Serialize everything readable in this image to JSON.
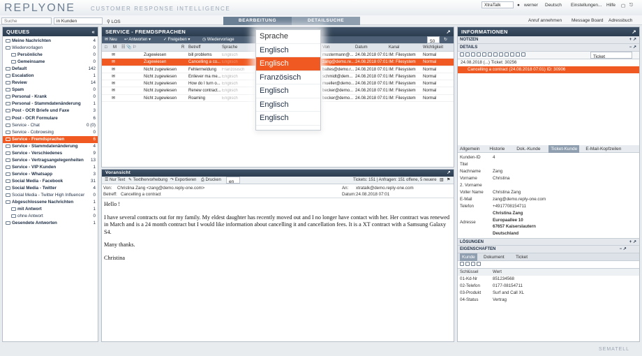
{
  "header": {
    "logo": "REPLYONE",
    "tagline": "CUSTOMER RESPONSE INTELLIGENCE",
    "app_select": "XtraTalk",
    "user": "werner",
    "language": "Deutsch",
    "settings": "Einstellungen...",
    "help": "Hilfe"
  },
  "search": {
    "placeholder": "Suche",
    "scope": "in Kunden",
    "go": "LOS"
  },
  "tabs": {
    "edit": "BEARBEITUNG",
    "search": "DETAILSUCHE"
  },
  "toplinks": {
    "call": "Anruf annehmen",
    "board": "Message Board",
    "book": "Adressbuch"
  },
  "queues": {
    "title": "QUEUES",
    "items": [
      {
        "label": "Meine Nachrichten",
        "count": "4"
      },
      {
        "label": "Wiedervorlagen",
        "count": "0",
        "plain": true
      },
      {
        "label": "Persönliche",
        "count": "0",
        "indent": true
      },
      {
        "label": "Gemeinsame",
        "count": "0",
        "indent": true
      },
      {
        "label": "Default",
        "count": "142"
      },
      {
        "label": "Escalation",
        "count": "1"
      },
      {
        "label": "Review",
        "count": "14"
      },
      {
        "label": "Spam",
        "count": "0"
      },
      {
        "label": "Personal - Krank",
        "count": "0"
      },
      {
        "label": "Personal - Stammdatenänderung",
        "count": "1"
      },
      {
        "label": "Post - OCR Briefe und Faxe",
        "count": "3"
      },
      {
        "label": "Post - OCR Formulare",
        "count": "6"
      },
      {
        "label": "Service - Chat",
        "count": "0 (0)",
        "plain": true
      },
      {
        "label": "Service - Cobrowsing",
        "count": "0",
        "plain": true
      },
      {
        "label": "Service - Fremdsprachen",
        "count": "6",
        "selected": true
      },
      {
        "label": "Service - Stammdatenänderung",
        "count": "4"
      },
      {
        "label": "Service - Verschiedenes",
        "count": "9"
      },
      {
        "label": "Service - Vertragsangelegenheiten",
        "count": "13"
      },
      {
        "label": "Service - VIP Kunden",
        "count": "1"
      },
      {
        "label": "Service - Whatsapp",
        "count": "3"
      },
      {
        "label": "Social Media - Facebook",
        "count": "31"
      },
      {
        "label": "Social Media - Twitter",
        "count": "4"
      },
      {
        "label": "Social Media - Twitter High Influencer",
        "count": "0",
        "plain": true
      },
      {
        "label": "Abgeschlossene Nachrichten",
        "count": "1"
      },
      {
        "label": "mit Antwort",
        "count": "1",
        "indent": true
      },
      {
        "label": "ohne Antwort",
        "count": "0",
        "indent": true,
        "plain": true
      },
      {
        "label": "Gesendete Antworten",
        "count": "1"
      }
    ]
  },
  "service": {
    "title": "SERVICE - FREMDSPRACHEN",
    "toolbar": {
      "new": "Neu",
      "reply": "Antworten",
      "release": "Freigeben",
      "followup": "Wiedervorlage",
      "pagesize": "50"
    },
    "columns": [
      "M",
      "R",
      "Betreff",
      "Sprache",
      "Von",
      "Datum",
      "Kanal",
      "Wichtigkeit"
    ],
    "rows": [
      {
        "status": "Zugewiesen",
        "subject": "bill problems",
        "lang": "Englisch",
        "from": "mustermann@...",
        "date": "24.08.2018 07:01",
        "channel": "IM: Filesystem",
        "prio": "Normal"
      },
      {
        "status": "Zugewiesen",
        "subject": "Cancelling a co...",
        "lang": "Englisch",
        "from": "zang@demo.re...",
        "date": "24.08.2018 07:01",
        "channel": "IM: Filesystem",
        "prio": "Normal",
        "selected": true
      },
      {
        "status": "Nicht zugewiesen",
        "subject": "Fehlermeldung",
        "lang": "Französisch",
        "from": "baltes@demo.r...",
        "date": "24.08.2018 07:01",
        "channel": "IM: Filesystem",
        "prio": "Normal"
      },
      {
        "status": "Nicht zugewiesen",
        "subject": "Enliever ma me...",
        "lang": "Englisch",
        "from": "schmidt@dem...",
        "date": "24.08.2018 07:01",
        "channel": "IM: Filesystem",
        "prio": "Normal"
      },
      {
        "status": "Nicht zugewiesen",
        "subject": "How do I turn o...",
        "lang": "Englisch",
        "from": "mueller@demo...",
        "date": "24.08.2018 07:01",
        "channel": "IM: Filesystem",
        "prio": "Normal"
      },
      {
        "status": "Nicht zugewiesen",
        "subject": "Renew contract...",
        "lang": "Englisch",
        "from": "becker@demo...",
        "date": "24.08.2018 07:01",
        "channel": "IM: Filesystem",
        "prio": "Normal"
      },
      {
        "status": "Nicht zugewiesen",
        "subject": "Roaming",
        "lang": "Englisch",
        "from": "becker@demo...",
        "date": "24.08.2018 07:01",
        "channel": "IM: Filesystem",
        "prio": "Normal"
      }
    ]
  },
  "dropdown": {
    "title": "Sprache",
    "options": [
      "Englisch",
      "Englisch",
      "Französisch",
      "Englisch",
      "Englisch",
      "Englisch"
    ],
    "selected_index": 1
  },
  "preview": {
    "title": "Voransicht",
    "toolbar": {
      "text": "Nur Text",
      "highlight": "Textlhervorhebung",
      "export": "Exportieren",
      "print": "Drucken",
      "lang": "en"
    },
    "tickets": "Tickets: 151 | Anfragen: 151 offene, 5 neuere",
    "from_label": "Von:",
    "from": "Christina Zang <zang@demo.reply-one.com>",
    "to_label": "An:",
    "to": "xtratalk@demo.reply-one.com",
    "subject_label": "Betreff:",
    "subject": "Cancelling a contract",
    "date_label": "Datum:",
    "date": "24.08.2018 07:01",
    "body": [
      "Hello !",
      "I have several contracts out for my family. My eldest daughter has recently moved out and I no longer have contact with her. Her contract was renewed in March and is a 24 month contract but I would like information about cancelling it and cancellation fees. It is a XT contract with a Samsung Galaxy S4.",
      "Many thanks.",
      "Christina"
    ]
  },
  "info": {
    "title": "INFORMATIONEN",
    "notes": "NOTIZEN",
    "details": "DETAILS",
    "ticket_select": "Ticket",
    "tree": [
      "24.08.2018 (...) Ticket: 30256",
      "Cancelling a contract (24.08.2018 07:01) ID: 30906"
    ],
    "tabs": [
      "Allgemein",
      "Historie",
      "Dok.-Kunde",
      "Ticket-Kunde",
      "E-Mail-Kopfzeilen"
    ],
    "fields": [
      [
        "Kunden-ID",
        "4"
      ],
      [
        "Titel",
        ""
      ],
      [
        "Nachname",
        "Zang"
      ],
      [
        "Vorname",
        "Christina"
      ],
      [
        "2. Vorname",
        ""
      ],
      [
        "Voller Name",
        "Christina Zang"
      ],
      [
        "E-Mail",
        "zang@demo.reply-one.com"
      ],
      [
        "Telefon",
        "+4917708154711"
      ]
    ],
    "address_label": "Adresse",
    "address": [
      "Christina Zang",
      "Europaallee 10",
      "67657 Kaiserslautern",
      "Deutschland"
    ],
    "solutions": "LÖSUNGEN",
    "props": "EIGENSCHAFTEN",
    "prop_tabs": [
      "Kunde",
      "Dokument",
      "Ticket"
    ],
    "prop_cols": [
      "Schlüssel",
      "Wert"
    ],
    "prop_rows": [
      [
        "01-Kd-Nr",
        "851234568"
      ],
      [
        "02-Telefon",
        "0177-08154711"
      ],
      [
        "03-Produkt",
        "Surf and Call XL"
      ],
      [
        "04-Status",
        "Vertrag"
      ]
    ]
  },
  "footer": {
    "brand": "SEMATELL"
  },
  "colors": {
    "accent": "#f05a22",
    "header": "#33475c"
  }
}
